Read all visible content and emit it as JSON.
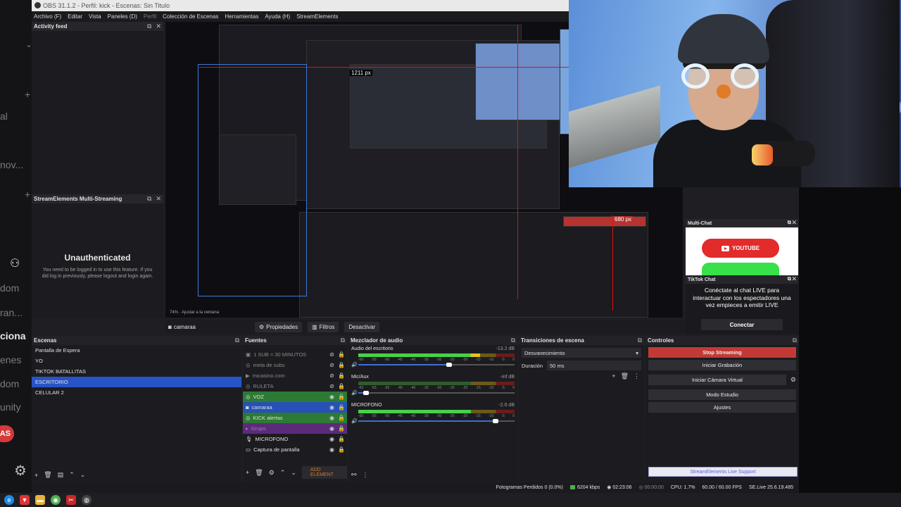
{
  "window": {
    "title": "OBS 31.1.2 - Perfil: kick - Escenas: Sin Titulo"
  },
  "menu": [
    {
      "label": "Archivo (F)",
      "dim": false
    },
    {
      "label": "Editar",
      "dim": false
    },
    {
      "label": "Vista",
      "dim": false
    },
    {
      "label": "Paneles (D)",
      "dim": false
    },
    {
      "label": "Perfil",
      "dim": true
    },
    {
      "label": "Colección de Escenas",
      "dim": false
    },
    {
      "label": "Herramientas",
      "dim": false
    },
    {
      "label": "Ayuda (H)",
      "dim": false
    },
    {
      "label": "StreamElements",
      "dim": false
    }
  ],
  "background_app": {
    "fragments": [
      "al",
      "nov...",
      "dom",
      "ran...",
      "ciona",
      "enes",
      "dom",
      "unity"
    ],
    "badge": "AS"
  },
  "activity_feed": {
    "title": "Activity feed"
  },
  "multistream": {
    "title": "StreamElements Multi-Streaming",
    "heading": "Unauthenticated",
    "message": "You need to be logged in to use this feature. If you did log in previously, please logout and login again."
  },
  "preview": {
    "measure_top": "1211 px",
    "measure_right": "680 px",
    "zoom": "74%",
    "fit": "Ajustar a la ventana"
  },
  "multichat": {
    "title": "Multi-Chat",
    "youtube_label": "YOUTUBE"
  },
  "tiktok": {
    "title": "TikTok Chat",
    "message": "Conéctate al chat LIVE para interactuar con los espectadores una vez empieces a emitir LIVE",
    "connect_label": "Conectar"
  },
  "source_toolbar": {
    "selected_source": "camaraa",
    "properties_label": "Propiedades",
    "filters_label": "Filtros",
    "fade_label": "Desactivar"
  },
  "scenes": {
    "title": "Escenas",
    "items": [
      {
        "label": "Pantalla de Espera",
        "selected": false
      },
      {
        "label": "YO",
        "selected": false
      },
      {
        "label": "TIKTOK BATALLITAS",
        "selected": false
      },
      {
        "label": "ESCRITORIO",
        "selected": true
      },
      {
        "label": "CELULAR 2",
        "selected": false
      }
    ]
  },
  "sources": {
    "title": "Fuentes",
    "add_element_label": "ADD ELEMENT",
    "items": [
      {
        "label": "1 SUB = 30 MINUTOS",
        "style": "dim",
        "icon": "image-icon"
      },
      {
        "label": "meta de subs",
        "style": "dim",
        "icon": "browser-icon"
      },
      {
        "label": "micasino.com",
        "style": "dim",
        "icon": "media-icon"
      },
      {
        "label": "RULETA",
        "style": "dim",
        "icon": "browser-icon"
      },
      {
        "label": "VOZ",
        "style": "green",
        "icon": "browser-icon"
      },
      {
        "label": "camaraa",
        "style": "blue",
        "icon": "camera-icon"
      },
      {
        "label": "KICK alertas",
        "style": "green",
        "icon": "browser-icon"
      },
      {
        "label": "Grupo",
        "style": "purple",
        "icon": "folder-icon"
      },
      {
        "label": "MICROFONO",
        "style": "normal",
        "icon": "mic-icon"
      },
      {
        "label": "Captura de pantalla",
        "style": "normal",
        "icon": "monitor-icon"
      }
    ]
  },
  "mixer": {
    "title": "Mezclador de audio",
    "ticks": [
      "-60",
      "-55",
      "-50",
      "-45",
      "-40",
      "-35",
      "-30",
      "-25",
      "-20",
      "-15",
      "-10",
      "-5",
      "0"
    ],
    "channels": [
      {
        "name": "Audio del escritorio",
        "db": "-13.2 dB",
        "level": 0.78,
        "volume": 0.58
      },
      {
        "name": "Mic/Aux",
        "db": "-inf dB",
        "level": 0.0,
        "volume": 0.05
      },
      {
        "name": "MICROFONO",
        "db": "-2.6 dB",
        "level": 0.72,
        "volume": 0.88
      }
    ]
  },
  "transitions": {
    "title": "Transiciones de escena",
    "selected": "Desvanecimiento",
    "duration_label": "Duración",
    "duration_value": "50 ms"
  },
  "controls": {
    "title": "Controles",
    "stop_streaming": "Stop Streaming",
    "start_recording": "Iniciar Grabación",
    "virtual_camera": "Iniciar Cámara Virtual",
    "studio_mode": "Modo Estudio",
    "settings": "Ajustes",
    "support": "StreamElements Live Support"
  },
  "status": {
    "dropped_frames": "Fotogramas Perdidos 0 (0.0%)",
    "bitrate": "6204 kbps",
    "stream_time": "02:23:06",
    "rec_time": "00:00:00",
    "cpu": "CPU: 1.7%",
    "fps": "60.00 / 60.00 FPS",
    "se_version": "SE.Live 25.6.19.485"
  },
  "colors": {
    "accent_blue": "#2755c8",
    "stop_red": "#c23a36",
    "source_green": "#2c7a34"
  }
}
